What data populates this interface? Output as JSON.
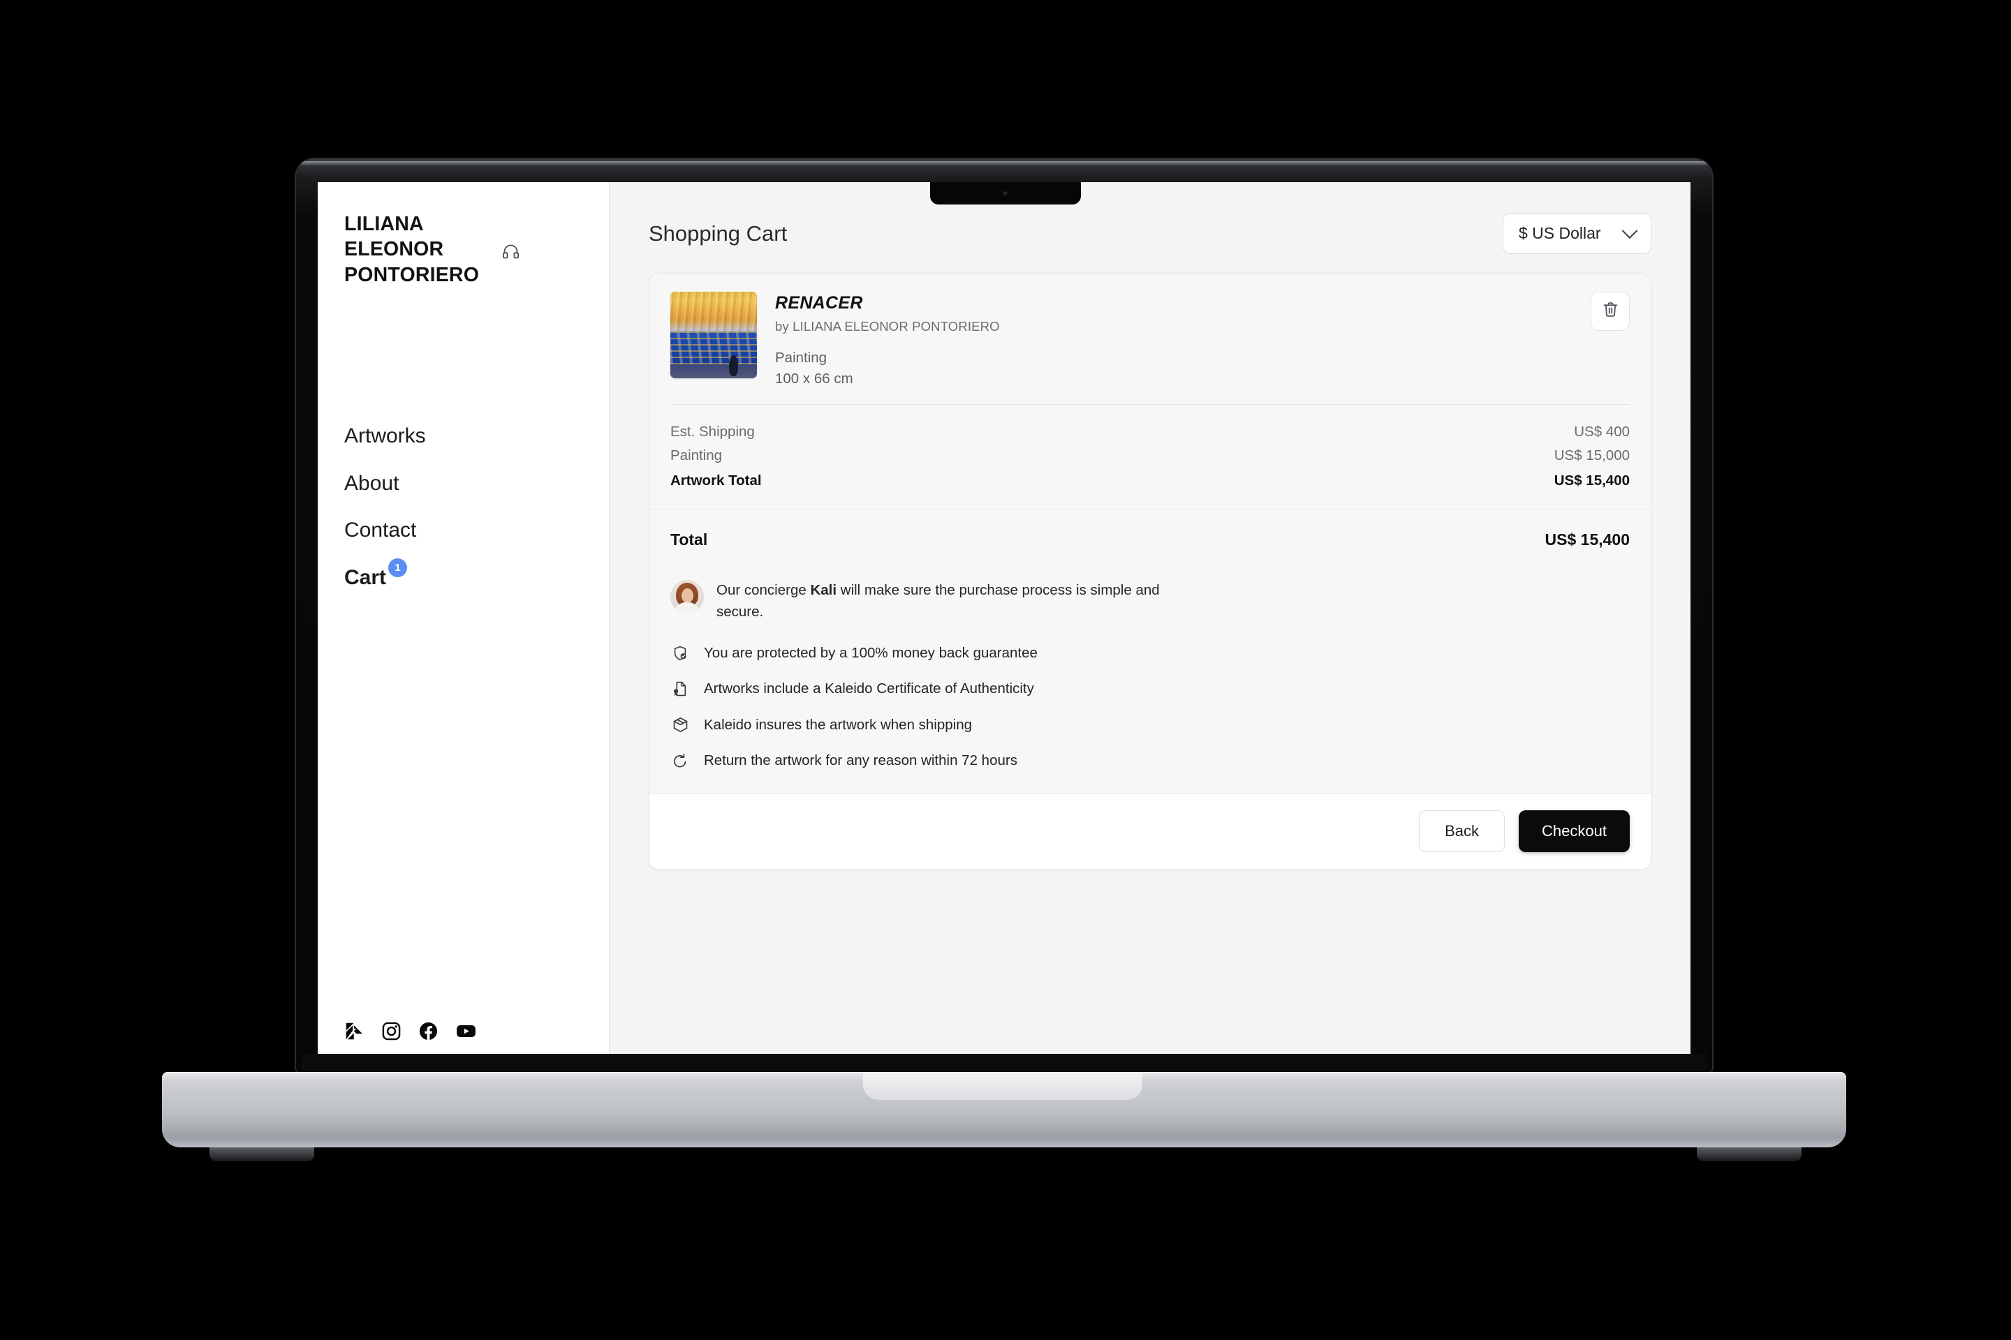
{
  "sidebar": {
    "brand": "LILIANA ELEONOR PONTORIERO",
    "support_icon": "headphones-icon",
    "nav": [
      {
        "label": "Artworks",
        "active": false
      },
      {
        "label": "About",
        "active": false
      },
      {
        "label": "Contact",
        "active": false
      },
      {
        "label": "Cart",
        "active": true,
        "badge": "1"
      }
    ],
    "socials": [
      {
        "name": "kaleido-logo-icon"
      },
      {
        "name": "instagram-icon"
      },
      {
        "name": "facebook-icon"
      },
      {
        "name": "youtube-icon"
      }
    ]
  },
  "main": {
    "page_title": "Shopping Cart",
    "currency": {
      "value": "$ US Dollar",
      "icon": "chevron-down-icon"
    }
  },
  "cart": {
    "item": {
      "title": "RENACER",
      "author": "by LILIANA ELEONOR PONTORIERO",
      "category": "Painting",
      "dimensions": "100 x 66 cm",
      "remove_icon": "trash-icon",
      "price_rows": [
        {
          "label": "Est. Shipping",
          "value": "US$ 400",
          "strong": false
        },
        {
          "label": "Painting",
          "value": "US$ 15,000",
          "strong": false
        },
        {
          "label": "Artwork Total",
          "value": "US$ 15,400",
          "strong": true
        }
      ]
    },
    "total": {
      "label": "Total",
      "value": "US$ 15,400"
    },
    "concierge": {
      "text_before": "Our concierge ",
      "name": "Kali",
      "text_after": " will make sure the purchase process is simple and secure.",
      "avatar": "concierge-avatar"
    },
    "features": [
      {
        "icon": "shield-check-icon",
        "text": "You are protected by a 100% money back guarantee"
      },
      {
        "icon": "certificate-icon",
        "text": "Artworks include a Kaleido Certificate of Authenticity"
      },
      {
        "icon": "package-icon",
        "text": "Kaleido insures the artwork when shipping"
      },
      {
        "icon": "return-arrow-icon",
        "text": "Return the artwork for any reason within 72 hours"
      }
    ],
    "actions": {
      "back": "Back",
      "checkout": "Checkout"
    }
  },
  "colors": {
    "badge": "#5b8df5",
    "checkout_bg": "#0b0b0b",
    "panel_bg": "#f7f7f7",
    "page_bg": "#f4f4f4"
  }
}
